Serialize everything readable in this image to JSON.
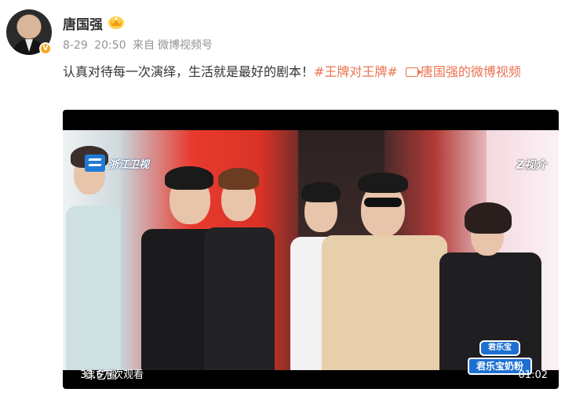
{
  "post": {
    "author": "唐国强",
    "date": "8-29",
    "time": "20:50",
    "source_prefix": "来自",
    "source": "微博视频号",
    "text": "认真对待每一次演绎，生活就是最好的剧本！",
    "hashtag": "#王牌对王牌#",
    "video_link_text": "唐国强的微博视频",
    "verified_badge": "V"
  },
  "video": {
    "channel_name": "浙江卫视",
    "platform_logo": "Z视介",
    "brand_top": "君乐宝",
    "brand_bottom": "君乐宝奶粉",
    "watermark": "综艺圈",
    "views": "33.6万次观看",
    "duration": "01:02"
  },
  "icons": {
    "crown": "crown-icon",
    "video_link": "video-link-icon",
    "verified": "verified-badge-icon"
  },
  "colors": {
    "link": "#eb7350",
    "meta_text": "#939393",
    "verified": "#f5a623",
    "channel": "#1e7bd8"
  }
}
